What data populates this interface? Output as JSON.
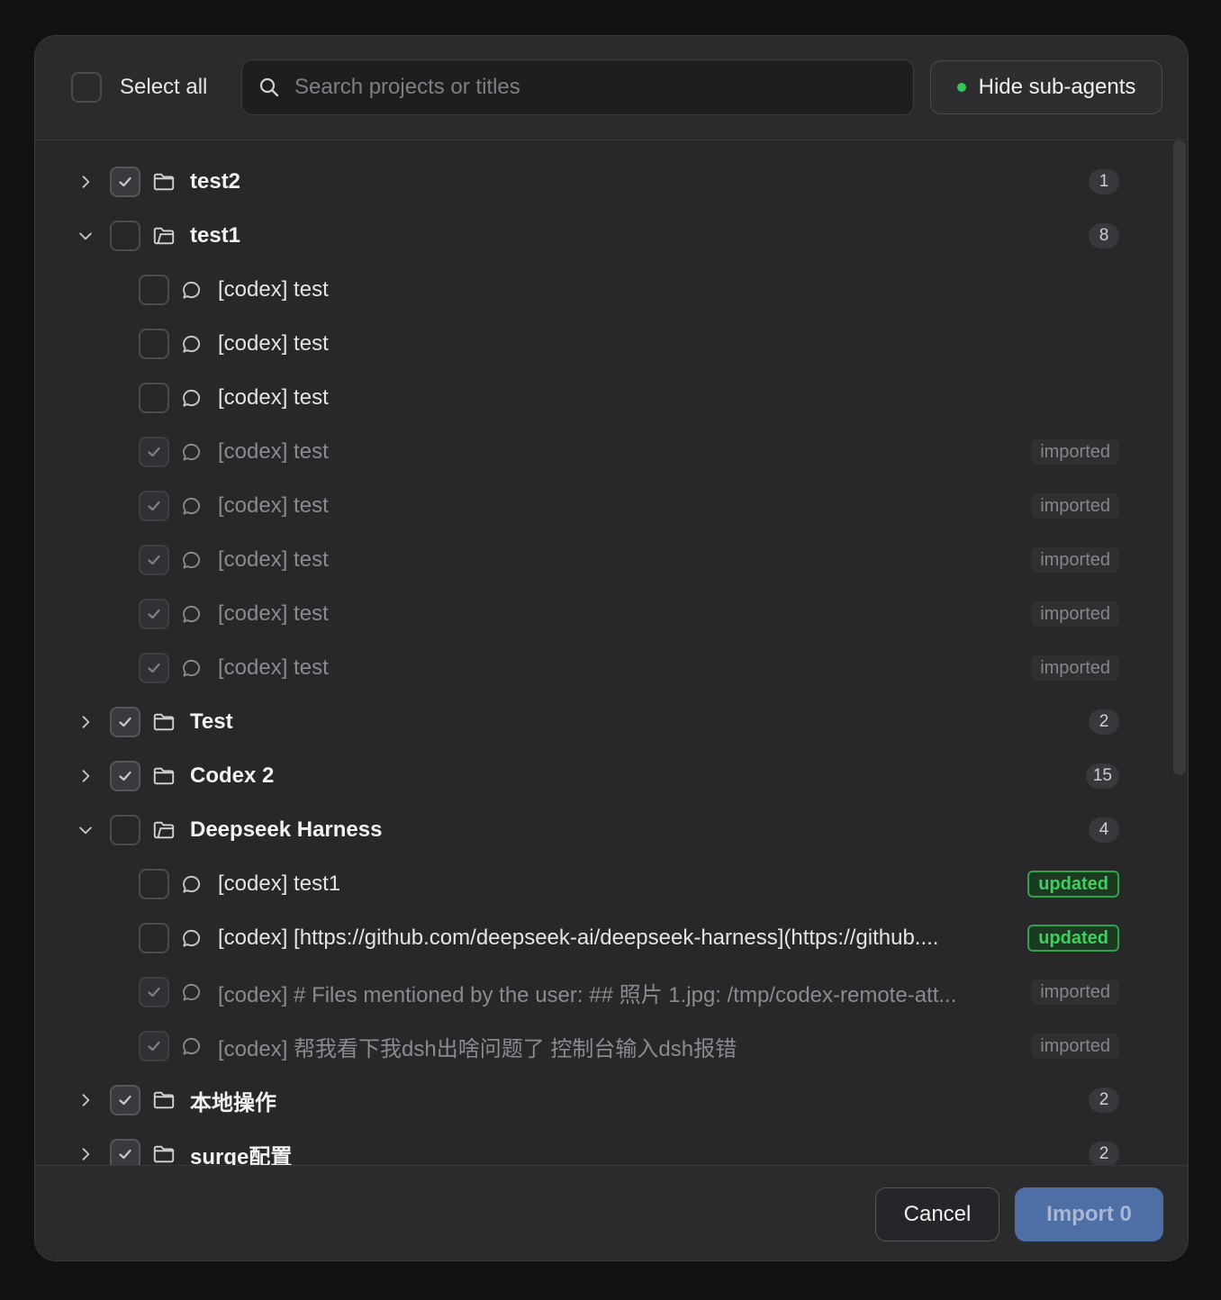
{
  "header": {
    "select_all_label": "Select all",
    "search_placeholder": "Search projects or titles",
    "hide_subagents_label": "Hide sub-agents"
  },
  "rows": [
    {
      "type": "project",
      "title": "test2",
      "count": "1",
      "expanded": false,
      "checked": true
    },
    {
      "type": "project",
      "title": "test1",
      "count": "8",
      "expanded": true,
      "checked": false
    },
    {
      "type": "item",
      "title": "[codex] test",
      "checked": false,
      "tag": ""
    },
    {
      "type": "item",
      "title": "[codex] test",
      "checked": false,
      "tag": ""
    },
    {
      "type": "item",
      "title": "[codex] test",
      "checked": false,
      "tag": ""
    },
    {
      "type": "item",
      "title": "[codex] test",
      "checked": true,
      "tag": "imported"
    },
    {
      "type": "item",
      "title": "[codex] test",
      "checked": true,
      "tag": "imported"
    },
    {
      "type": "item",
      "title": "[codex] test",
      "checked": true,
      "tag": "imported"
    },
    {
      "type": "item",
      "title": "[codex] test",
      "checked": true,
      "tag": "imported"
    },
    {
      "type": "item",
      "title": "[codex] test",
      "checked": true,
      "tag": "imported"
    },
    {
      "type": "project",
      "title": "Test",
      "count": "2",
      "expanded": false,
      "checked": true
    },
    {
      "type": "project",
      "title": "Codex 2",
      "count": "15",
      "expanded": false,
      "checked": true
    },
    {
      "type": "project",
      "title": "Deepseek Harness",
      "count": "4",
      "expanded": true,
      "checked": false
    },
    {
      "type": "item",
      "title": "[codex] test1",
      "checked": false,
      "tag": "updated"
    },
    {
      "type": "item",
      "title": "[codex] [https://github.com/deepseek-ai/deepseek-harness](https://github....",
      "checked": false,
      "tag": "updated"
    },
    {
      "type": "item",
      "title": "[codex] # Files mentioned by the user: ## 照片 1.jpg: /tmp/codex-remote-att...",
      "checked": true,
      "tag": "imported"
    },
    {
      "type": "item",
      "title": "[codex] 帮我看下我dsh出啥问题了 控制台输入dsh报错",
      "checked": true,
      "tag": "imported"
    },
    {
      "type": "project",
      "title": "本地操作",
      "count": "2",
      "expanded": false,
      "checked": true
    },
    {
      "type": "project",
      "title": "surge配置",
      "count": "2",
      "expanded": false,
      "checked": true
    }
  ],
  "footer": {
    "cancel_label": "Cancel",
    "import_label": "Import 0"
  },
  "colors": {
    "accent_green": "#34c759",
    "import_button": "#4e6ea6",
    "updated_tag": "#3fcf5f"
  }
}
